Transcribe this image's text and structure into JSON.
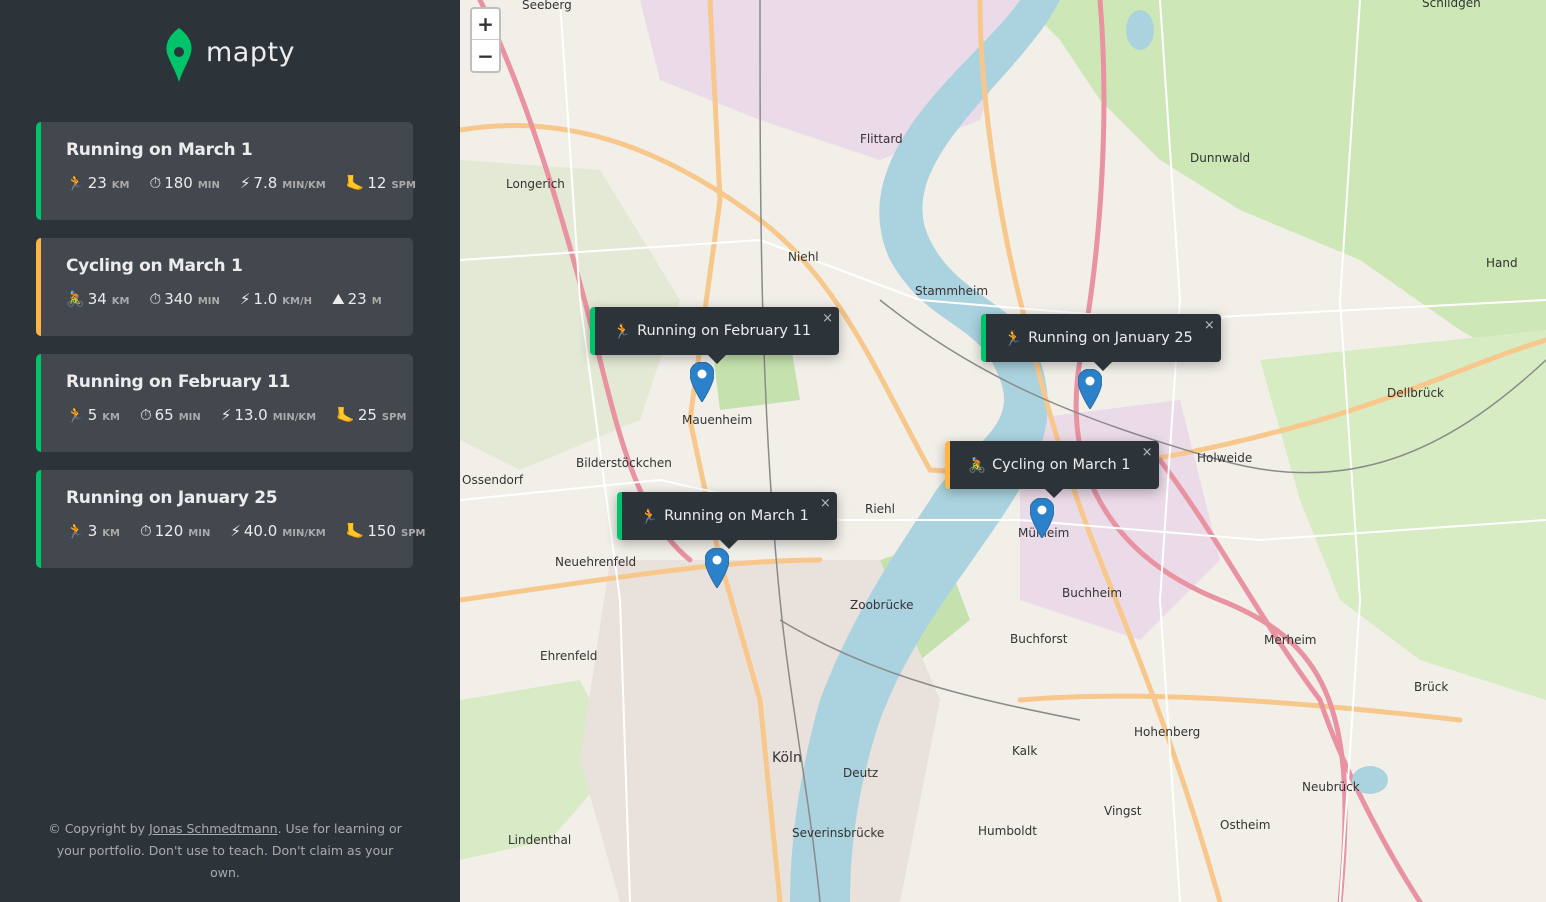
{
  "brand": {
    "name": "mapty"
  },
  "workouts": [
    {
      "type": "running",
      "title": "Running on March 1",
      "d1": {
        "icon": "🏃",
        "value": "23",
        "unit": "km"
      },
      "d2": {
        "icon": "⏱",
        "value": "180",
        "unit": "min"
      },
      "d3": {
        "icon": "⚡",
        "value": "7.8",
        "unit": "min/km"
      },
      "d4": {
        "icon": "🦶",
        "value": "12",
        "unit": "spm"
      }
    },
    {
      "type": "cycling",
      "title": "Cycling on March 1",
      "d1": {
        "icon": "🚴",
        "value": "34",
        "unit": "km"
      },
      "d2": {
        "icon": "⏱",
        "value": "340",
        "unit": "min"
      },
      "d3": {
        "icon": "⚡",
        "value": "1.0",
        "unit": "km/h"
      },
      "d4": {
        "icon": "⛰",
        "value": "23",
        "unit": "m"
      }
    },
    {
      "type": "running",
      "title": "Running on February 11",
      "d1": {
        "icon": "🏃",
        "value": "5",
        "unit": "km"
      },
      "d2": {
        "icon": "⏱",
        "value": "65",
        "unit": "min"
      },
      "d3": {
        "icon": "⚡",
        "value": "13.0",
        "unit": "min/km"
      },
      "d4": {
        "icon": "🦶",
        "value": "25",
        "unit": "spm"
      }
    },
    {
      "type": "running",
      "title": "Running on January 25",
      "d1": {
        "icon": "🏃",
        "value": "3",
        "unit": "km"
      },
      "d2": {
        "icon": "⏱",
        "value": "120",
        "unit": "min"
      },
      "d3": {
        "icon": "⚡",
        "value": "40.0",
        "unit": "min/km"
      },
      "d4": {
        "icon": "🦶",
        "value": "150",
        "unit": "spm"
      }
    }
  ],
  "copyright": {
    "prefix": "© Copyright by",
    "author": "Jonas Schmedtmann",
    "suffix": ". Use for learning or your portfolio. Don't use to teach. Don't claim as your own."
  },
  "map": {
    "zoom_in": "+",
    "zoom_out": "−",
    "popups": [
      {
        "type": "running",
        "icon": "🏃",
        "label": "Running on February 11",
        "close": "×"
      },
      {
        "type": "running",
        "icon": "🏃",
        "label": "Running on January 25",
        "close": "×"
      },
      {
        "type": "cycling",
        "icon": "🚴",
        "label": "Cycling on March 1",
        "close": "×"
      },
      {
        "type": "running",
        "icon": "🏃",
        "label": "Running on March 1",
        "close": "×"
      }
    ],
    "labels": {
      "koln": "Köln",
      "deutz": "Deutz",
      "mulheim": "Mülheim",
      "riehl": "Riehl",
      "niehl": "Niehl",
      "stammheim": "Stammheim",
      "flittard": "Flittard",
      "dunnwald": "Dunnwald",
      "holweide": "Holweide",
      "dellbruck": "Dellbrück",
      "buchheim": "Buchheim",
      "buchforst": "Buchforst",
      "kalk": "Kalk",
      "vingst": "Vingst",
      "hohenberg": "Hohenberg",
      "humboldt": "Humboldt",
      "ostheim": "Ostheim",
      "merheim": "Merheim",
      "bruck": "Brück",
      "neubruck": "Neubrück",
      "hand": "Hand",
      "ehrenfeld": "Ehrenfeld",
      "neuehrenfeld": "Neuehrenfeld",
      "bilderstockchen": "Bilderstöckchen",
      "mauenheim": "Mauenheim",
      "longerich": "Longerich",
      "lindenthal": "Lindenthal",
      "ossendorf": "Ossendorf",
      "zoobrucke": "Zoobrücke",
      "seeberg": "Seeberg",
      "schildgen": "Schildgen",
      "severinsbrucke": "Severinsbrücke"
    }
  }
}
